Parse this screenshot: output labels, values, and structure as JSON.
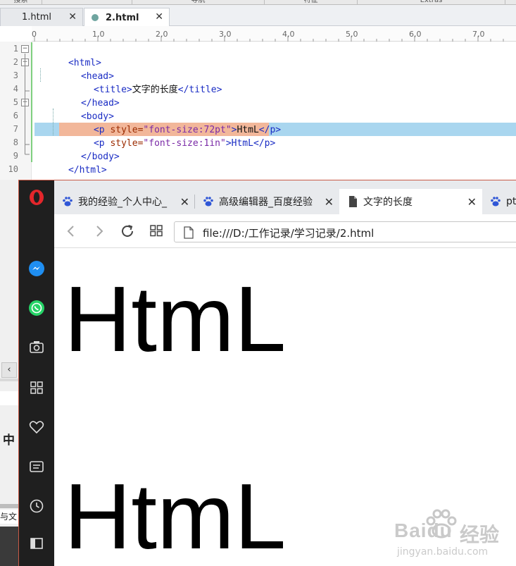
{
  "editor": {
    "top_menu": [
      "搜索",
      "导航",
      "特征",
      "Extras"
    ],
    "tabs": [
      {
        "label": "1.html",
        "close": "✕",
        "active": false
      },
      {
        "label": "2.html",
        "close": "✕",
        "active": true
      }
    ],
    "ruler_numbers": [
      "0",
      "1,0",
      "2,0",
      "3,0",
      "4,0",
      "5,0",
      "6,0",
      "7,0"
    ],
    "line_numbers": [
      "1",
      "2",
      "3",
      "4",
      "5",
      "6",
      "7",
      "8",
      "9",
      "10"
    ],
    "code": {
      "l1": "<html>",
      "l2": "<head>",
      "l3_open": "<title>",
      "l3_text": "文字的长度",
      "l3_close": "</title>",
      "l4": "</head>",
      "l5": "<body>",
      "l6_p": "<p",
      "l6_attr": " style=",
      "l6_val": "\"font-size:72pt\"",
      "l6_gt": ">",
      "l6_text": "HtmL",
      "l6_close": "</p>",
      "l7_p": "<p",
      "l7_attr": " style=",
      "l7_val": "\"font-size:1in\"",
      "l7_gt": ">",
      "l7_text": "HtmL",
      "l7_close": "</p>",
      "l8": "</body>",
      "l9": "</html>"
    },
    "left_fragments": {
      "a": "中",
      "b": "与文"
    }
  },
  "browser": {
    "tabs": [
      {
        "label": "我的经验_个人中心_",
        "close": "✕",
        "icon": "baidu-paw-icon"
      },
      {
        "label": "高级编辑器_百度经验",
        "close": "✕",
        "icon": "baidu-paw-icon"
      },
      {
        "label": "文字的长度",
        "close": "✕",
        "icon": "document-icon",
        "active": true
      },
      {
        "label": "pt",
        "icon": "baidu-paw-icon"
      }
    ],
    "url": "file:///D:/工作记录/学习记录/2.html",
    "page_lines": [
      "HtmL",
      "HtmL"
    ]
  },
  "watermark": {
    "brand": "Baidu",
    "cn": "经验",
    "site": "jingyan.baidu.com"
  },
  "colors": {
    "selection": "#f2b79a",
    "line_highlight": "#a9d6ef",
    "opera_red": "#e3262b",
    "messenger_blue": "#1f8ef1",
    "whatsapp_green": "#25d366"
  }
}
